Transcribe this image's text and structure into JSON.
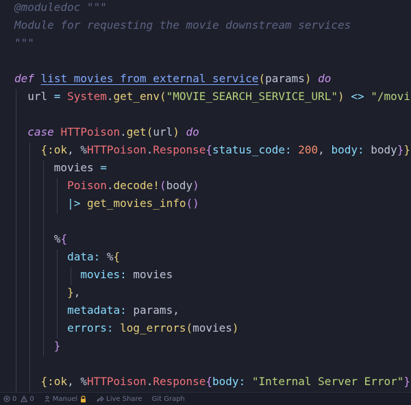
{
  "editor": {
    "lines": [
      [
        {
          "t": "@moduledoc \"\"\"",
          "c": "cm"
        }
      ],
      [
        {
          "t": "Module for requesting the movie downstream services",
          "c": "cm"
        }
      ],
      [
        {
          "t": "\"\"\"",
          "c": "cm"
        }
      ],
      [],
      [
        {
          "t": "def",
          "c": "kw"
        },
        {
          "t": " ",
          "c": "pl"
        },
        {
          "t": "list_movies_from_external_service",
          "c": "fnu"
        },
        {
          "t": "(",
          "c": "br1"
        },
        {
          "t": "params",
          "c": "param"
        },
        {
          "t": ")",
          "c": "br1"
        },
        {
          "t": " ",
          "c": "pl"
        },
        {
          "t": "do",
          "c": "kw"
        }
      ],
      [
        {
          "t": "  url ",
          "c": "pl"
        },
        {
          "t": "=",
          "c": "op"
        },
        {
          "t": " ",
          "c": "pl"
        },
        {
          "t": "System",
          "c": "mod"
        },
        {
          "t": ".",
          "c": "pl"
        },
        {
          "t": "get_env",
          "c": "call"
        },
        {
          "t": "(",
          "c": "br1"
        },
        {
          "t": "\"MOVIE_SEARCH_SERVICE_URL\"",
          "c": "str"
        },
        {
          "t": ")",
          "c": "br1"
        },
        {
          "t": " ",
          "c": "pl"
        },
        {
          "t": "<>",
          "c": "op"
        },
        {
          "t": " ",
          "c": "pl"
        },
        {
          "t": "\"/movies\"",
          "c": "str"
        }
      ],
      [],
      [
        {
          "t": "  ",
          "c": "pl"
        },
        {
          "t": "case",
          "c": "kw"
        },
        {
          "t": " ",
          "c": "pl"
        },
        {
          "t": "HTTPoison",
          "c": "mod"
        },
        {
          "t": ".",
          "c": "pl"
        },
        {
          "t": "get",
          "c": "call"
        },
        {
          "t": "(",
          "c": "br1"
        },
        {
          "t": "url",
          "c": "pl"
        },
        {
          "t": ")",
          "c": "br1"
        },
        {
          "t": " ",
          "c": "pl"
        },
        {
          "t": "do",
          "c": "kw"
        }
      ],
      [
        {
          "t": "    ",
          "c": "pl"
        },
        {
          "t": "{",
          "c": "br1"
        },
        {
          "t": ":ok",
          "c": "atom"
        },
        {
          "t": ", ",
          "c": "pl"
        },
        {
          "t": "%",
          "c": "pl"
        },
        {
          "t": "HTTPoison",
          "c": "mod"
        },
        {
          "t": ".",
          "c": "pl"
        },
        {
          "t": "Response",
          "c": "mod"
        },
        {
          "t": "{",
          "c": "br2"
        },
        {
          "t": "status_code:",
          "c": "key"
        },
        {
          "t": " ",
          "c": "pl"
        },
        {
          "t": "200",
          "c": "num"
        },
        {
          "t": ", ",
          "c": "pl"
        },
        {
          "t": "body:",
          "c": "key"
        },
        {
          "t": " body",
          "c": "pl"
        },
        {
          "t": "}",
          "c": "br2"
        },
        {
          "t": "}",
          "c": "br1"
        },
        {
          "t": " ",
          "c": "pl"
        },
        {
          "t": "->",
          "c": "op"
        }
      ],
      [
        {
          "t": "      movies ",
          "c": "pl"
        },
        {
          "t": "=",
          "c": "op"
        }
      ],
      [
        {
          "t": "        ",
          "c": "pl"
        },
        {
          "t": "Poison",
          "c": "mod"
        },
        {
          "t": ".",
          "c": "pl"
        },
        {
          "t": "decode!",
          "c": "call"
        },
        {
          "t": "(",
          "c": "br2"
        },
        {
          "t": "body",
          "c": "pl"
        },
        {
          "t": ")",
          "c": "br2"
        }
      ],
      [
        {
          "t": "        ",
          "c": "pl"
        },
        {
          "t": "|>",
          "c": "op"
        },
        {
          "t": " ",
          "c": "pl"
        },
        {
          "t": "get_movies_info",
          "c": "call"
        },
        {
          "t": "()",
          "c": "br2"
        }
      ],
      [],
      [
        {
          "t": "      %",
          "c": "pl"
        },
        {
          "t": "{",
          "c": "br2"
        }
      ],
      [
        {
          "t": "        ",
          "c": "pl"
        },
        {
          "t": "data:",
          "c": "key"
        },
        {
          "t": " %",
          "c": "pl"
        },
        {
          "t": "{",
          "c": "br1"
        }
      ],
      [
        {
          "t": "          ",
          "c": "pl"
        },
        {
          "t": "movies:",
          "c": "key"
        },
        {
          "t": " movies",
          "c": "pl"
        }
      ],
      [
        {
          "t": "        ",
          "c": "pl"
        },
        {
          "t": "}",
          "c": "br1"
        },
        {
          "t": ",",
          "c": "pl"
        }
      ],
      [
        {
          "t": "        ",
          "c": "pl"
        },
        {
          "t": "metadata:",
          "c": "key"
        },
        {
          "t": " params,",
          "c": "pl"
        }
      ],
      [
        {
          "t": "        ",
          "c": "pl"
        },
        {
          "t": "errors:",
          "c": "key"
        },
        {
          "t": " ",
          "c": "pl"
        },
        {
          "t": "log_errors",
          "c": "call"
        },
        {
          "t": "(",
          "c": "br1"
        },
        {
          "t": "movies",
          "c": "pl"
        },
        {
          "t": ")",
          "c": "br1"
        }
      ],
      [
        {
          "t": "      ",
          "c": "pl"
        },
        {
          "t": "}",
          "c": "br2"
        }
      ],
      [],
      [
        {
          "t": "    ",
          "c": "pl"
        },
        {
          "t": "{",
          "c": "br1"
        },
        {
          "t": ":ok",
          "c": "atom"
        },
        {
          "t": ", ",
          "c": "pl"
        },
        {
          "t": "%",
          "c": "pl"
        },
        {
          "t": "HTTPoison",
          "c": "mod"
        },
        {
          "t": ".",
          "c": "pl"
        },
        {
          "t": "Response",
          "c": "mod"
        },
        {
          "t": "{",
          "c": "br2"
        },
        {
          "t": "body:",
          "c": "key"
        },
        {
          "t": " ",
          "c": "pl"
        },
        {
          "t": "\"Internal Server Error\"",
          "c": "str"
        },
        {
          "t": "}",
          "c": "br2"
        },
        {
          "t": "}",
          "c": "br1"
        }
      ]
    ]
  },
  "statusbar": {
    "errors_count": "0",
    "warnings_count": "0",
    "user": "Manuel",
    "live_share": "Live Share",
    "git_graph": "Git Graph"
  },
  "colors": {
    "background": "#1d1f2b",
    "comment": "#5d6482",
    "keyword": "#c792ea",
    "function": "#82aaff",
    "module": "#f07178",
    "string": "#b8d47c",
    "number": "#f78c6c",
    "key": "#89ddff"
  },
  "icons": {
    "errors": "error-circle-icon",
    "warnings": "warning-triangle-icon",
    "user": "person-icon",
    "lock": "lock-icon",
    "live_share": "live-share-icon"
  }
}
